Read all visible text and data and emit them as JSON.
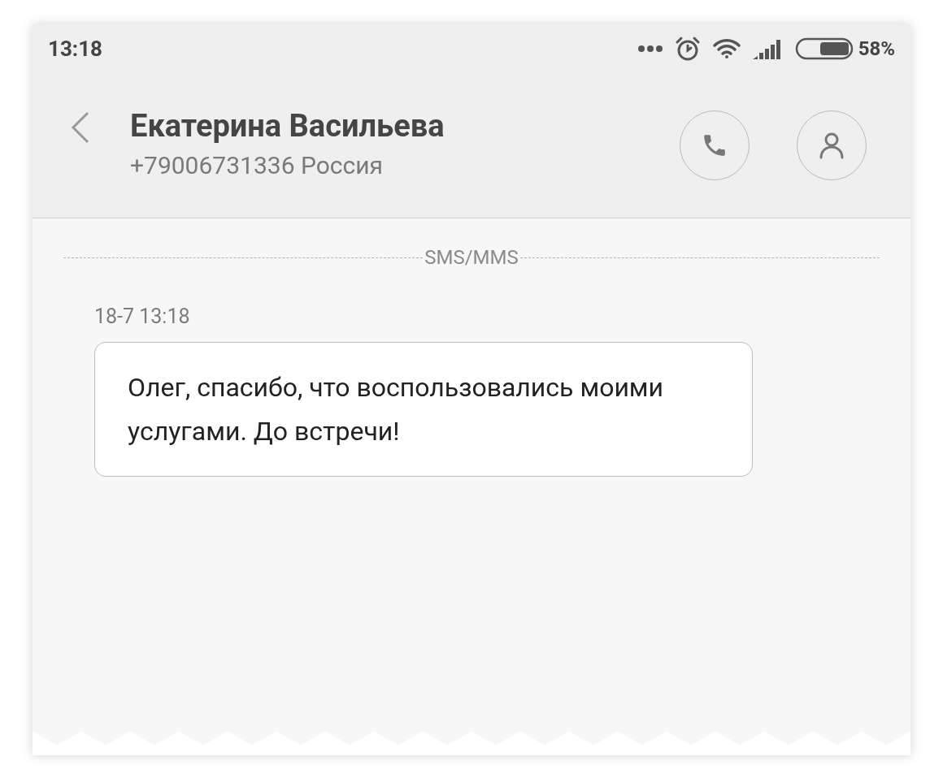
{
  "status_bar": {
    "time": "13:18",
    "battery_percent": "58%"
  },
  "header": {
    "contact_name": "Екатерина Васильева",
    "contact_detail": "+79006731336 Россия"
  },
  "conversation": {
    "channel_label": "SMS/MMS",
    "messages": [
      {
        "timestamp": "18-7 13:18",
        "text": "Олег, спасибо, что воспользовались моими услугами. До встречи!"
      }
    ]
  }
}
